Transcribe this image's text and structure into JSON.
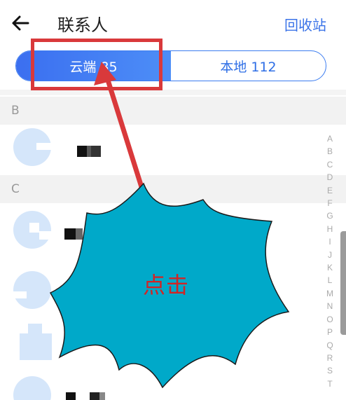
{
  "header": {
    "title": "联系人",
    "recycle_label": "回收站"
  },
  "segment": {
    "cloud_label": "云端 85",
    "local_label": "本地 112"
  },
  "groups": {
    "b": "B",
    "c": "C"
  },
  "alphabet": [
    "A",
    "B",
    "C",
    "D",
    "E",
    "F",
    "G",
    "H",
    "I",
    "J",
    "K",
    "L",
    "M",
    "N",
    "O",
    "P",
    "Q",
    "R",
    "S",
    "T"
  ],
  "annotation": {
    "click_label": "点击"
  },
  "colors": {
    "accent": "#3a73e8",
    "annotation_red": "#d9393b",
    "burst_fill": "#00a9c9",
    "avatar_light": "#d5e6fa"
  }
}
